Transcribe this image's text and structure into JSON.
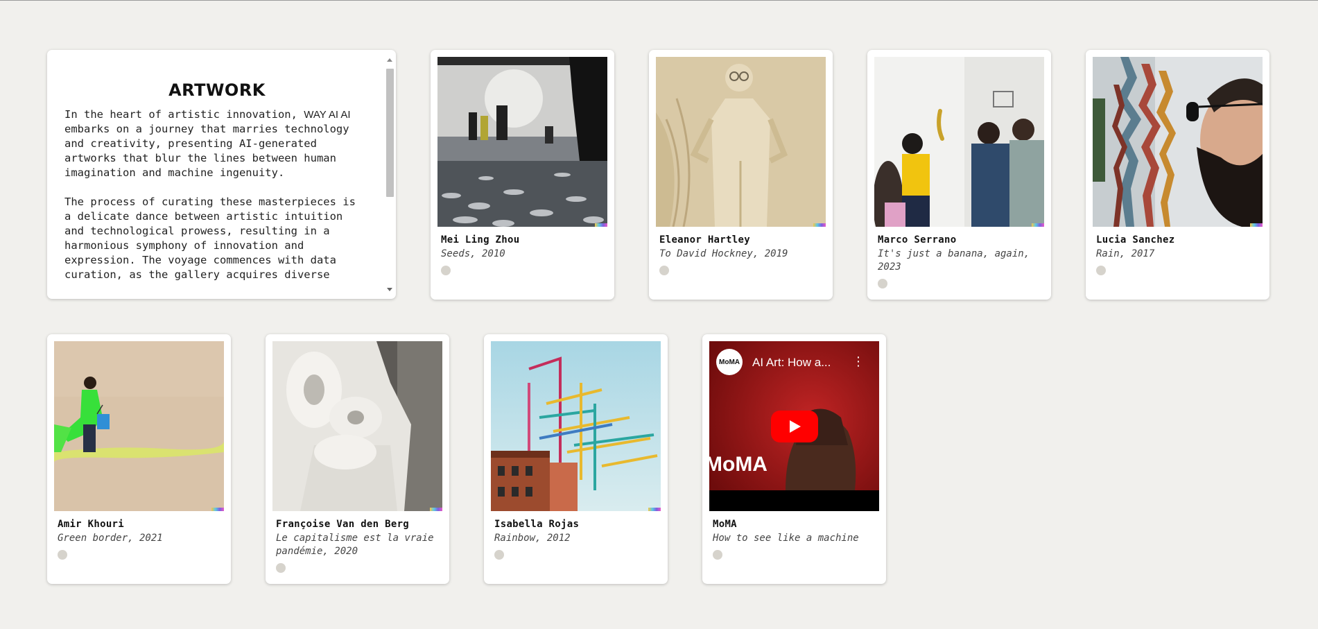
{
  "intro": {
    "title": "ARTWORK",
    "p1_pre": "In the heart of artistic innovation, ",
    "brand": "WAY AI AI",
    "p1_post": "\nembarks on a journey that marries technology\nand creativity, presenting AI-generated\nartworks that blur the lines between human\nimagination and machine ingenuity.",
    "p2": "The process of curating these masterpieces is\na delicate dance between artistic intuition\nand technological prowess, resulting in a\nharmonious symphony of innovation and\nexpression. The voyage commences with data\ncuration, as the gallery acquires diverse"
  },
  "artworks": [
    {
      "artist": "Mei Ling Zhou",
      "title": "Seeds, 2010"
    },
    {
      "artist": "Eleanor Hartley",
      "title": "To David Hockney, 2019"
    },
    {
      "artist": "Marco Serrano",
      "title": "It's just a banana, again,\n2023"
    },
    {
      "artist": "Lucia Sanchez",
      "title": "Rain, 2017"
    },
    {
      "artist": "Amir Khouri",
      "title": "Green border, 2021"
    },
    {
      "artist": "Françoise Van den Berg",
      "title": "Le capitalisme est la vraie\npandémie, 2020"
    },
    {
      "artist": "Isabella Rojas",
      "title": "Rainbow, 2012"
    },
    {
      "artist": "MoMA",
      "title": "How to see like a machine"
    }
  ],
  "video": {
    "channel_logo": "MoMA",
    "title": "AI Art: How a...",
    "overlay_text": "MoMA",
    "menu_icon": "⋮"
  },
  "colors": {
    "background": "#f1f0ed",
    "card": "#ffffff",
    "youtube_red": "#ff0000"
  }
}
